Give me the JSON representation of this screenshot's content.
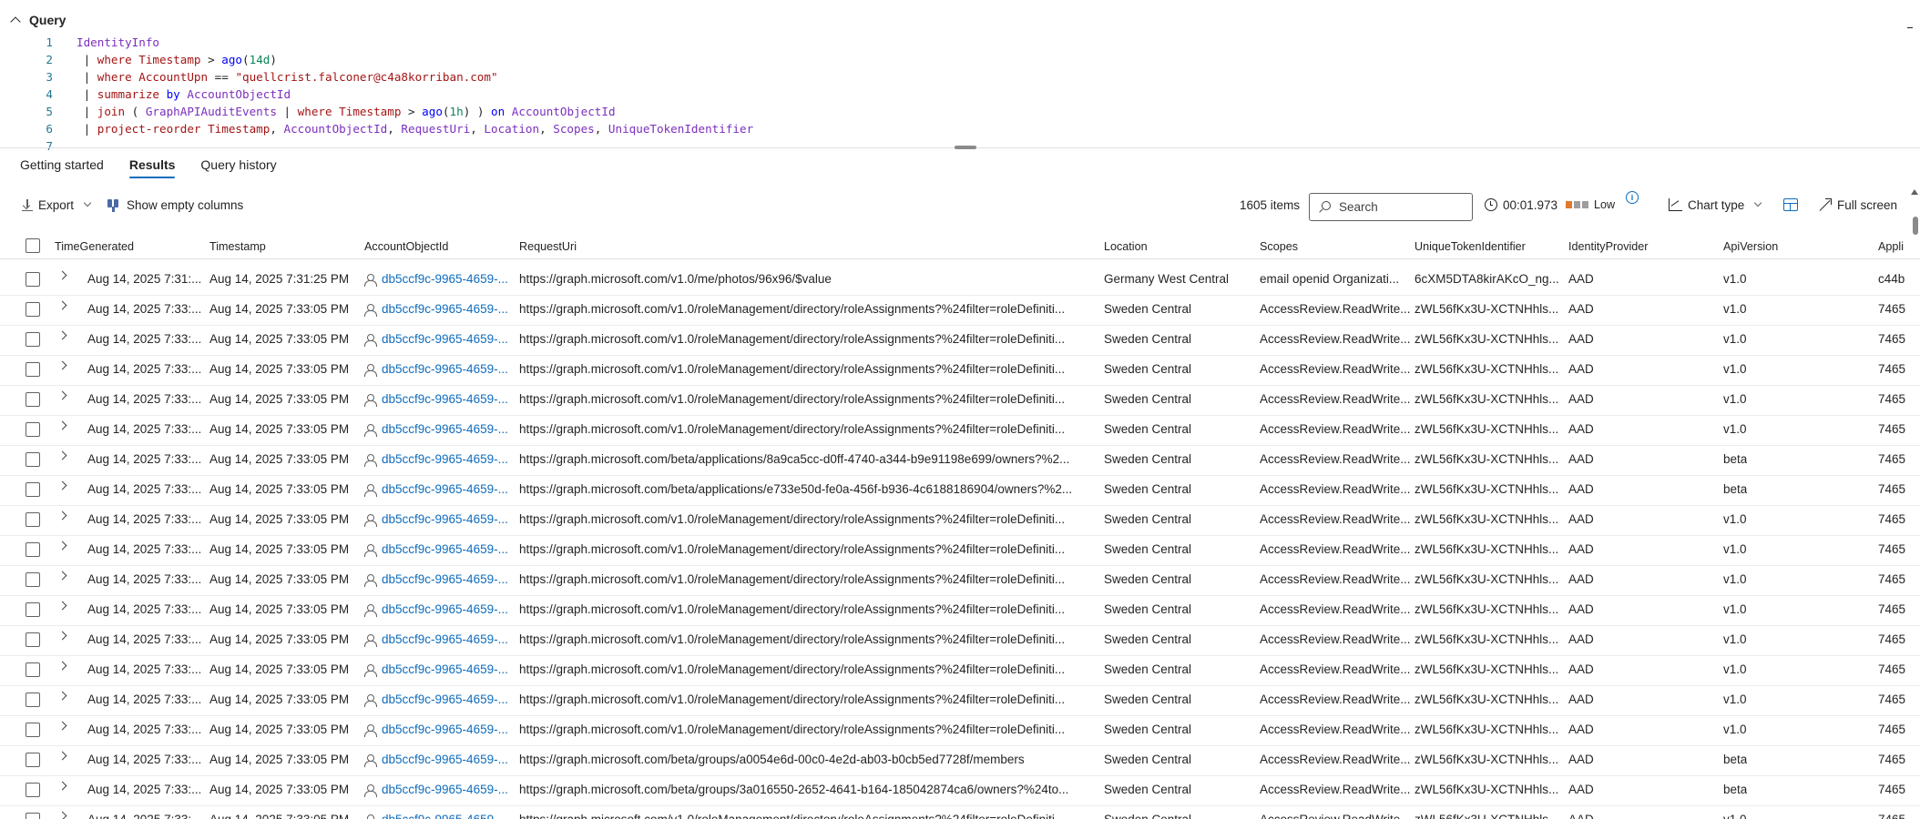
{
  "query": {
    "title": "Query",
    "lines": [
      {
        "n": "1",
        "tokens": [
          {
            "t": "IdentityInfo",
            "c": "tok-id"
          }
        ]
      },
      {
        "n": "2",
        "tokens": [
          {
            "t": " | ",
            "c": "tok-pipe"
          },
          {
            "t": "where",
            "c": "tb"
          },
          {
            "t": " ",
            "c": ""
          },
          {
            "t": "Timestamp",
            "c": "tok-col"
          },
          {
            "t": " > ",
            "c": "tok-op"
          },
          {
            "t": "ago",
            "c": "kw"
          },
          {
            "t": "(",
            "c": ""
          },
          {
            "t": "14d",
            "c": "tok-num"
          },
          {
            "t": ")",
            "c": ""
          }
        ]
      },
      {
        "n": "3",
        "tokens": [
          {
            "t": " | ",
            "c": "tok-pipe"
          },
          {
            "t": "where",
            "c": "tb"
          },
          {
            "t": " ",
            "c": ""
          },
          {
            "t": "AccountUpn",
            "c": "tok-col"
          },
          {
            "t": " == ",
            "c": "tok-op"
          },
          {
            "t": "\"quellcrist.falconer@c4a8korriban.com\"",
            "c": "str"
          }
        ]
      },
      {
        "n": "4",
        "tokens": [
          {
            "t": " | ",
            "c": "tok-pipe"
          },
          {
            "t": "summarize",
            "c": "tb"
          },
          {
            "t": " ",
            "c": ""
          },
          {
            "t": "by",
            "c": "kw"
          },
          {
            "t": " ",
            "c": ""
          },
          {
            "t": "AccountObjectId",
            "c": "tok-id"
          }
        ]
      },
      {
        "n": "5",
        "tokens": [
          {
            "t": " | ",
            "c": "tok-pipe"
          },
          {
            "t": "join",
            "c": "tb"
          },
          {
            "t": " ( ",
            "c": ""
          },
          {
            "t": "GraphAPIAuditEvents",
            "c": "tok-id"
          },
          {
            "t": " | ",
            "c": "tok-pipe"
          },
          {
            "t": "where",
            "c": "tb"
          },
          {
            "t": " ",
            "c": ""
          },
          {
            "t": "Timestamp",
            "c": "tok-col"
          },
          {
            "t": " > ",
            "c": "tok-op"
          },
          {
            "t": "ago",
            "c": "kw"
          },
          {
            "t": "(",
            "c": ""
          },
          {
            "t": "1h",
            "c": "tok-num"
          },
          {
            "t": ") ) ",
            "c": ""
          },
          {
            "t": "on",
            "c": "kw"
          },
          {
            "t": " ",
            "c": ""
          },
          {
            "t": "AccountObjectId",
            "c": "tok-id"
          }
        ]
      },
      {
        "n": "6",
        "tokens": [
          {
            "t": " | ",
            "c": "tok-pipe"
          },
          {
            "t": "project-reorder",
            "c": "tb"
          },
          {
            "t": " ",
            "c": ""
          },
          {
            "t": "Timestamp",
            "c": "tok-col"
          },
          {
            "t": ", ",
            "c": ""
          },
          {
            "t": "AccountObjectId",
            "c": "tok-id"
          },
          {
            "t": ", ",
            "c": ""
          },
          {
            "t": "RequestUri",
            "c": "tok-id"
          },
          {
            "t": ", ",
            "c": ""
          },
          {
            "t": "Location",
            "c": "tok-id"
          },
          {
            "t": ", ",
            "c": ""
          },
          {
            "t": "Scopes",
            "c": "tok-id"
          },
          {
            "t": ", ",
            "c": ""
          },
          {
            "t": "UniqueTokenIdentifier",
            "c": "tok-id"
          }
        ]
      },
      {
        "n": "7",
        "tokens": []
      }
    ]
  },
  "tabs": [
    {
      "label": "Getting started",
      "active": false
    },
    {
      "label": "Results",
      "active": true
    },
    {
      "label": "Query history",
      "active": false
    }
  ],
  "toolbar": {
    "export_label": "Export",
    "show_empty_label": "Show empty columns",
    "items_count": "1605 items",
    "search_placeholder": "Search",
    "duration": "00:01.973",
    "level_label": "Low",
    "level_colors": [
      "#e07a2f",
      "#9e9e9e",
      "#9e9e9e"
    ],
    "info_glyph": "i",
    "chart_type_label": "Chart type",
    "full_screen_label": "Full screen"
  },
  "table": {
    "columns": [
      "TimeGenerated",
      "Timestamp",
      "AccountObjectId",
      "RequestUri",
      "Location",
      "Scopes",
      "UniqueTokenIdentifier",
      "IdentityProvider",
      "ApiVersion",
      "Appli"
    ],
    "rows": [
      [
        "Aug 14, 2025 7:31:...",
        "Aug 14, 2025 7:31:25 PM",
        "db5ccf9c-9965-4659-...",
        "https://graph.microsoft.com/v1.0/me/photos/96x96/$value",
        "Germany West Central",
        "email openid Organizati...",
        "6cXM5DTA8kirAKcO_ng...",
        "AAD",
        "v1.0",
        "c44b"
      ],
      [
        "Aug 14, 2025 7:33:...",
        "Aug 14, 2025 7:33:05 PM",
        "db5ccf9c-9965-4659-...",
        "https://graph.microsoft.com/v1.0/roleManagement/directory/roleAssignments?%24filter=roleDefiniti...",
        "Sweden Central",
        "AccessReview.ReadWrite...",
        "zWL56fKx3U-XCTNHhls...",
        "AAD",
        "v1.0",
        "7465"
      ],
      [
        "Aug 14, 2025 7:33:...",
        "Aug 14, 2025 7:33:05 PM",
        "db5ccf9c-9965-4659-...",
        "https://graph.microsoft.com/v1.0/roleManagement/directory/roleAssignments?%24filter=roleDefiniti...",
        "Sweden Central",
        "AccessReview.ReadWrite...",
        "zWL56fKx3U-XCTNHhls...",
        "AAD",
        "v1.0",
        "7465"
      ],
      [
        "Aug 14, 2025 7:33:...",
        "Aug 14, 2025 7:33:05 PM",
        "db5ccf9c-9965-4659-...",
        "https://graph.microsoft.com/v1.0/roleManagement/directory/roleAssignments?%24filter=roleDefiniti...",
        "Sweden Central",
        "AccessReview.ReadWrite...",
        "zWL56fKx3U-XCTNHhls...",
        "AAD",
        "v1.0",
        "7465"
      ],
      [
        "Aug 14, 2025 7:33:...",
        "Aug 14, 2025 7:33:05 PM",
        "db5ccf9c-9965-4659-...",
        "https://graph.microsoft.com/v1.0/roleManagement/directory/roleAssignments?%24filter=roleDefiniti...",
        "Sweden Central",
        "AccessReview.ReadWrite...",
        "zWL56fKx3U-XCTNHhls...",
        "AAD",
        "v1.0",
        "7465"
      ],
      [
        "Aug 14, 2025 7:33:...",
        "Aug 14, 2025 7:33:05 PM",
        "db5ccf9c-9965-4659-...",
        "https://graph.microsoft.com/v1.0/roleManagement/directory/roleAssignments?%24filter=roleDefiniti...",
        "Sweden Central",
        "AccessReview.ReadWrite...",
        "zWL56fKx3U-XCTNHhls...",
        "AAD",
        "v1.0",
        "7465"
      ],
      [
        "Aug 14, 2025 7:33:...",
        "Aug 14, 2025 7:33:05 PM",
        "db5ccf9c-9965-4659-...",
        "https://graph.microsoft.com/beta/applications/8a9ca5cc-d0ff-4740-a344-b9e91198e699/owners?%2...",
        "Sweden Central",
        "AccessReview.ReadWrite...",
        "zWL56fKx3U-XCTNHhls...",
        "AAD",
        "beta",
        "7465"
      ],
      [
        "Aug 14, 2025 7:33:...",
        "Aug 14, 2025 7:33:05 PM",
        "db5ccf9c-9965-4659-...",
        "https://graph.microsoft.com/beta/applications/e733e50d-fe0a-456f-b936-4c6188186904/owners?%2...",
        "Sweden Central",
        "AccessReview.ReadWrite...",
        "zWL56fKx3U-XCTNHhls...",
        "AAD",
        "beta",
        "7465"
      ],
      [
        "Aug 14, 2025 7:33:...",
        "Aug 14, 2025 7:33:05 PM",
        "db5ccf9c-9965-4659-...",
        "https://graph.microsoft.com/v1.0/roleManagement/directory/roleAssignments?%24filter=roleDefiniti...",
        "Sweden Central",
        "AccessReview.ReadWrite...",
        "zWL56fKx3U-XCTNHhls...",
        "AAD",
        "v1.0",
        "7465"
      ],
      [
        "Aug 14, 2025 7:33:...",
        "Aug 14, 2025 7:33:05 PM",
        "db5ccf9c-9965-4659-...",
        "https://graph.microsoft.com/v1.0/roleManagement/directory/roleAssignments?%24filter=roleDefiniti...",
        "Sweden Central",
        "AccessReview.ReadWrite...",
        "zWL56fKx3U-XCTNHhls...",
        "AAD",
        "v1.0",
        "7465"
      ],
      [
        "Aug 14, 2025 7:33:...",
        "Aug 14, 2025 7:33:05 PM",
        "db5ccf9c-9965-4659-...",
        "https://graph.microsoft.com/v1.0/roleManagement/directory/roleAssignments?%24filter=roleDefiniti...",
        "Sweden Central",
        "AccessReview.ReadWrite...",
        "zWL56fKx3U-XCTNHhls...",
        "AAD",
        "v1.0",
        "7465"
      ],
      [
        "Aug 14, 2025 7:33:...",
        "Aug 14, 2025 7:33:05 PM",
        "db5ccf9c-9965-4659-...",
        "https://graph.microsoft.com/v1.0/roleManagement/directory/roleAssignments?%24filter=roleDefiniti...",
        "Sweden Central",
        "AccessReview.ReadWrite...",
        "zWL56fKx3U-XCTNHhls...",
        "AAD",
        "v1.0",
        "7465"
      ],
      [
        "Aug 14, 2025 7:33:...",
        "Aug 14, 2025 7:33:05 PM",
        "db5ccf9c-9965-4659-...",
        "https://graph.microsoft.com/v1.0/roleManagement/directory/roleAssignments?%24filter=roleDefiniti...",
        "Sweden Central",
        "AccessReview.ReadWrite...",
        "zWL56fKx3U-XCTNHhls...",
        "AAD",
        "v1.0",
        "7465"
      ],
      [
        "Aug 14, 2025 7:33:...",
        "Aug 14, 2025 7:33:05 PM",
        "db5ccf9c-9965-4659-...",
        "https://graph.microsoft.com/v1.0/roleManagement/directory/roleAssignments?%24filter=roleDefiniti...",
        "Sweden Central",
        "AccessReview.ReadWrite...",
        "zWL56fKx3U-XCTNHhls...",
        "AAD",
        "v1.0",
        "7465"
      ],
      [
        "Aug 14, 2025 7:33:...",
        "Aug 14, 2025 7:33:05 PM",
        "db5ccf9c-9965-4659-...",
        "https://graph.microsoft.com/v1.0/roleManagement/directory/roleAssignments?%24filter=roleDefiniti...",
        "Sweden Central",
        "AccessReview.ReadWrite...",
        "zWL56fKx3U-XCTNHhls...",
        "AAD",
        "v1.0",
        "7465"
      ],
      [
        "Aug 14, 2025 7:33:...",
        "Aug 14, 2025 7:33:05 PM",
        "db5ccf9c-9965-4659-...",
        "https://graph.microsoft.com/v1.0/roleManagement/directory/roleAssignments?%24filter=roleDefiniti...",
        "Sweden Central",
        "AccessReview.ReadWrite...",
        "zWL56fKx3U-XCTNHhls...",
        "AAD",
        "v1.0",
        "7465"
      ],
      [
        "Aug 14, 2025 7:33:...",
        "Aug 14, 2025 7:33:05 PM",
        "db5ccf9c-9965-4659-...",
        "https://graph.microsoft.com/beta/groups/a0054e6d-00c0-4e2d-ab03-b0cb5ed7728f/members",
        "Sweden Central",
        "AccessReview.ReadWrite...",
        "zWL56fKx3U-XCTNHhls...",
        "AAD",
        "beta",
        "7465"
      ],
      [
        "Aug 14, 2025 7:33:...",
        "Aug 14, 2025 7:33:05 PM",
        "db5ccf9c-9965-4659-...",
        "https://graph.microsoft.com/beta/groups/3a016550-2652-4641-b164-185042874ca6/owners?%24to...",
        "Sweden Central",
        "AccessReview.ReadWrite...",
        "zWL56fKx3U-XCTNHhls...",
        "AAD",
        "beta",
        "7465"
      ],
      [
        "Aug 14, 2025 7:33:...",
        "Aug 14, 2025 7:33:05 PM",
        "db5ccf9c-9965-4659-...",
        "https://graph.microsoft.com/v1.0/roleManagement/directory/roleAssignments?%24filter=roleDefiniti...",
        "Sweden Central",
        "AccessReview.ReadWrite...",
        "zWL56fKx3U-XCTNHhls...",
        "AAD",
        "v1.0",
        "7465"
      ]
    ]
  }
}
